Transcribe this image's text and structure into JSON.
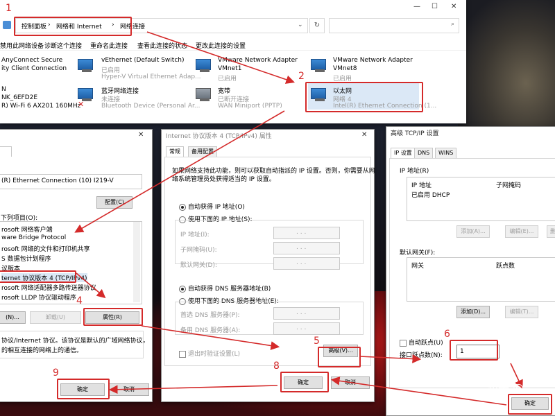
{
  "explorer": {
    "breadcrumb": [
      "控制面板",
      "网络和 Internet",
      "网络连接"
    ],
    "sep": "›",
    "toolbar": [
      "禁用此网络设备",
      "诊断这个连接",
      "重命名此连接",
      "查看此连接的状态",
      "更改此连接的设置"
    ],
    "adapters": [
      {
        "name": "AnyConnect Secure",
        "status": "ity Client Connection",
        "device": ""
      },
      {
        "name": "vEthernet (Default Switch)",
        "status": "已启用",
        "device": "Hyper-V Virtual Ethernet Adap..."
      },
      {
        "name": "VMware Network Adapter",
        "status": "VMnet1",
        "device": "已启用"
      },
      {
        "name": "VMware Network Adapter",
        "status": "VMnet8",
        "device": "已启用"
      },
      {
        "name": "N",
        "status": "NK_6EFD2E",
        "device": "R) Wi-Fi 6 AX201 160MHz"
      },
      {
        "name": "蓝牙网络连接",
        "status": "未连接",
        "device": "Bluetooth Device (Personal Ar..."
      },
      {
        "name": "宽带",
        "status": "已断开连接",
        "device": "WAN Miniport (PPTP)"
      },
      {
        "name": "以太网",
        "status": "网络 4",
        "device": "Intel(R) Ethernet Connection (1..."
      }
    ]
  },
  "props": {
    "adapter": "(R) Ethernet Connection (10) I219-V",
    "configure": "配置(C)",
    "items_label": "下列项目(O):",
    "items": [
      "rosoft 网络客户端",
      "ware Bridge Protocol",
      "rosoft 网络的文件和打印机共享",
      "S 数据包计划程序",
      "议版本",
      "ternet 协议版本 4 (TCP/IPv4)",
      "rosoft 网络适配器多路传送器协议",
      "rosoft LLDP 协议驱动程序"
    ],
    "install": "(N)...",
    "uninstall": "卸载(U)",
    "properties": "属性(R)",
    "desc1": "协议/Internet 协议。该协议是默认的广域网络协议，",
    "desc2": "的相互连接的网络上的通信。",
    "ok": "确定",
    "cancel": "取消"
  },
  "ipv4": {
    "title": "Internet 协议版本 4 (TCP/IPv4) 属性",
    "tabs": [
      "常规",
      "备用配置"
    ],
    "intro1": "如果网络支持此功能，则可以获取自动指派的 IP 设置。否则，你需要从网",
    "intro2": "络系统管理员处获得适当的 IP 设置。",
    "auto_ip": "自动获得 IP 地址(O)",
    "manual_ip": "使用下面的 IP 地址(S):",
    "ip_label": "IP 地址(I):",
    "mask_label": "子网掩码(U):",
    "gateway_label": "默认网关(D):",
    "auto_dns": "自动获得 DNS 服务器地址(B)",
    "manual_dns": "使用下面的 DNS 服务器地址(E):",
    "pref_dns": "首选 DNS 服务器(P):",
    "alt_dns": "备用 DNS 服务器(A):",
    "validate": "退出时验证设置(L)",
    "advanced": "高级(V)...",
    "ok": "确定",
    "cancel": "取消",
    "dots": ". . ."
  },
  "adv": {
    "title": "高级 TCP/IP 设置",
    "tabs": [
      "IP 设置",
      "DNS",
      "WINS"
    ],
    "ip_group": "IP 地址(R)",
    "col_ip": "IP 地址",
    "col_mask": "子网掩码",
    "dhcp": "已启用 DHCP",
    "add": "添加(A)...",
    "edit": "编辑(E)...",
    "del": "删",
    "gw_group": "默认网关(F):",
    "col_gw": "网关",
    "col_metric": "跃点数",
    "add2": "添加(D)...",
    "edit2": "编辑(T)...",
    "auto_metric": "自动跃点(U)",
    "iface_metric": "接口跃点数(N):",
    "metric_value": "1",
    "ok": "确定"
  },
  "steps": [
    "1",
    "2",
    "4",
    "5",
    "6",
    "8",
    "9"
  ],
  "watermark": "知乎 @"
}
